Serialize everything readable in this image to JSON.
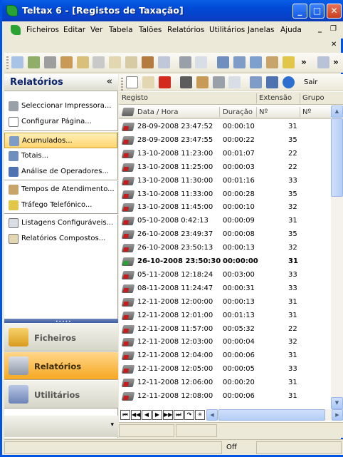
{
  "window": {
    "title": "Teltax 6 - [Registos de Taxação]"
  },
  "titlebar_buttons": {
    "minimize": "_",
    "maximize": "□",
    "close": "✕"
  },
  "menu": {
    "items": [
      "Ficheiros",
      "Editar",
      "Ver",
      "Tabela",
      "Talões",
      "Relatórios",
      "Utilitários",
      "Janelas",
      "Ajuda"
    ],
    "mdi_minimize": "_",
    "mdi_restore": "❐",
    "mdi_close": "✕"
  },
  "toolbar1": {
    "more": "»"
  },
  "left_panel": {
    "title": "Relatórios",
    "collapse": "«",
    "groups": [
      [
        "Seleccionar Impressora...",
        "Configurar Página..."
      ],
      [
        "Acumulados...",
        "Totais...",
        "Análise de Operadores..."
      ],
      [
        "Tempos de Atendimento...",
        "Tráfego Telefónico..."
      ],
      [
        "Listagens Configuráveis...",
        "Relatórios Compostos..."
      ]
    ],
    "selected": "Acumulados...",
    "nav": [
      {
        "label": "Ficheiros",
        "active": false
      },
      {
        "label": "Relatórios",
        "active": true
      },
      {
        "label": "Utilitários",
        "active": false
      }
    ],
    "nav_more": "▾"
  },
  "toolbar2": {
    "more": "»",
    "sair": "Sair"
  },
  "grid": {
    "band_headers": {
      "registo": "Registo",
      "extensao": "Extensão",
      "grupo": "Grupo"
    },
    "columns": {
      "datetime": "Data / Hora",
      "duration": "Duração",
      "ext_no": "Nº",
      "grp_no": "Nº"
    },
    "rows": [
      {
        "dt": "28-09-2008 23:47:52",
        "du": "00:00:10",
        "ex": "31",
        "bold": false
      },
      {
        "dt": "28-09-2008 23:47:55",
        "du": "00:00:22",
        "ex": "35",
        "bold": false
      },
      {
        "dt": "13-10-2008 11:23:00",
        "du": "00:01:07",
        "ex": "22",
        "bold": false
      },
      {
        "dt": "13-10-2008 11:25:00",
        "du": "00:00:03",
        "ex": "22",
        "bold": false
      },
      {
        "dt": "13-10-2008 11:30:00",
        "du": "00:01:16",
        "ex": "33",
        "bold": false
      },
      {
        "dt": "13-10-2008 11:33:00",
        "du": "00:00:28",
        "ex": "35",
        "bold": false
      },
      {
        "dt": "13-10-2008 11:45:00",
        "du": "00:00:10",
        "ex": "32",
        "bold": false
      },
      {
        "dt": "05-10-2008 0:42:13",
        "du": "00:00:09",
        "ex": "31",
        "bold": false
      },
      {
        "dt": "26-10-2008 23:49:37",
        "du": "00:00:08",
        "ex": "35",
        "bold": false
      },
      {
        "dt": "26-10-2008 23:50:13",
        "du": "00:00:13",
        "ex": "32",
        "bold": false
      },
      {
        "dt": "26-10-2008 23:50:30",
        "du": "00:00:00",
        "ex": "31",
        "bold": true
      },
      {
        "dt": "05-11-2008 12:18:24",
        "du": "00:03:00",
        "ex": "33",
        "bold": false
      },
      {
        "dt": "08-11-2008 11:24:47",
        "du": "00:00:31",
        "ex": "33",
        "bold": false
      },
      {
        "dt": "12-11-2008 12:00:00",
        "du": "00:00:13",
        "ex": "31",
        "bold": false
      },
      {
        "dt": "12-11-2008 12:01:00",
        "du": "00:01:13",
        "ex": "31",
        "bold": false
      },
      {
        "dt": "12-11-2008 11:57:00",
        "du": "00:05:32",
        "ex": "22",
        "bold": false
      },
      {
        "dt": "12-11-2008 12:03:00",
        "du": "00:00:04",
        "ex": "32",
        "bold": false
      },
      {
        "dt": "12-11-2008 12:04:00",
        "du": "00:00:06",
        "ex": "31",
        "bold": false
      },
      {
        "dt": "12-11-2008 12:05:00",
        "du": "00:00:05",
        "ex": "33",
        "bold": false
      },
      {
        "dt": "12-11-2008 12:06:00",
        "du": "00:00:20",
        "ex": "31",
        "bold": false
      },
      {
        "dt": "12-11-2008 12:08:00",
        "du": "00:00:06",
        "ex": "31",
        "bold": false
      }
    ],
    "navigator": [
      "⏮",
      "◀◀",
      "◀",
      "▶",
      "▶▶",
      "⏭",
      "↷",
      "✳"
    ]
  },
  "statusbar": {
    "off": "Off"
  },
  "colors": {
    "titlebar": "#0049d4",
    "selection": "#ffd46e",
    "accent": "#0a246a"
  }
}
